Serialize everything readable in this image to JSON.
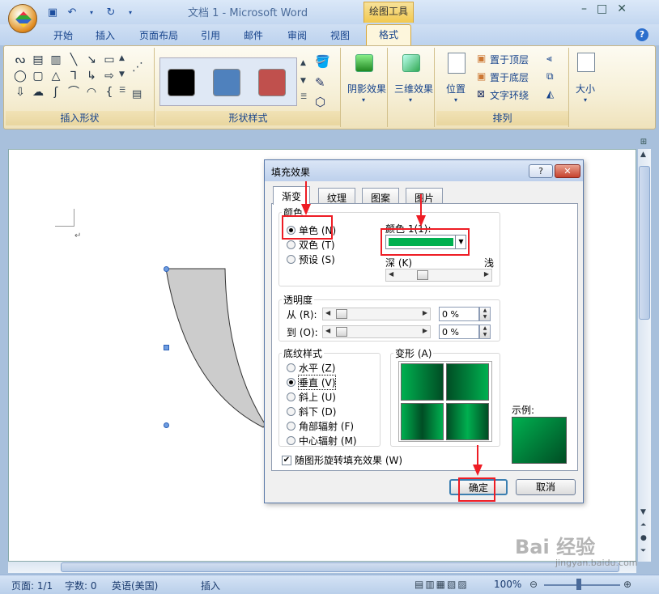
{
  "window": {
    "title": "文档 1 - Microsoft Word",
    "context_tab": "绘图工具",
    "minimize": "–",
    "maximize": "□",
    "close": "✕"
  },
  "tabs": [
    "开始",
    "插入",
    "页面布局",
    "引用",
    "邮件",
    "审阅",
    "视图"
  ],
  "active_tab": "格式",
  "help_label": "?",
  "ribbon": {
    "insert_shapes_label": "插入形状",
    "shape_styles_label": "形状样式",
    "shadow_label": "阴影效果",
    "threed_label": "三维效果",
    "position_label": "位置",
    "bring_front": "置于顶层",
    "send_back": "置于底层",
    "text_wrap": "文字环绕",
    "arrange_label": "排列",
    "size_label": "大小",
    "swatch_colors": [
      "#000000",
      "#4f81bd",
      "#c0504d"
    ]
  },
  "dialog": {
    "title": "填充效果",
    "help": "?",
    "close": "✕",
    "tabs": [
      "渐变",
      "纹理",
      "图案",
      "图片"
    ],
    "colors_group": "颜色",
    "color_one": "单色 (N)",
    "color_two": "双色 (T)",
    "color_preset": "预设 (S)",
    "color1_label": "颜色 1(1):",
    "color1_value": "#00b050",
    "dark_label": "深 (K)",
    "light_label": "浅",
    "transparency_group": "透明度",
    "from_label": "从 (R):",
    "to_label": "到 (O):",
    "from_value": "0 %",
    "to_value": "0 %",
    "shading_group": "底纹样式",
    "shading_options": [
      "水平 (Z)",
      "垂直 (V)",
      "斜上 (U)",
      "斜下 (D)",
      "角部辐射 (F)",
      "中心辐射 (M)"
    ],
    "shading_selected": 1,
    "variants_label": "变形 (A)",
    "sample_label": "示例:",
    "rotate_checkbox": "随图形旋转填充效果 (W)",
    "ok": "确定",
    "cancel": "取消"
  },
  "status": {
    "page": "页面: 1/1",
    "words": "字数: 0",
    "language": "英语(美国)",
    "mode": "插入",
    "zoom": "100%"
  },
  "watermark": "Bai 经验",
  "watermark_url": "jingyan.baidu.com"
}
